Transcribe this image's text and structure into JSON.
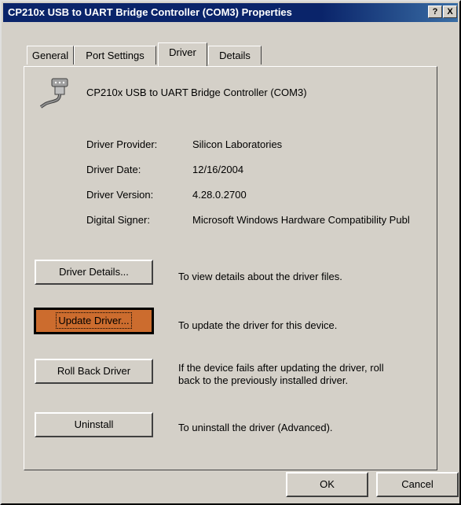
{
  "window": {
    "title": "CP210x USB to UART Bridge Controller (COM3) Properties",
    "help_btn": "?",
    "close_btn": "X"
  },
  "tabs": [
    {
      "label": "General"
    },
    {
      "label": "Port Settings"
    },
    {
      "label": "Driver",
      "active": true
    },
    {
      "label": "Details"
    }
  ],
  "device": {
    "icon": "serial-port-icon",
    "name": "CP210x USB to UART Bridge Controller (COM3)"
  },
  "properties": [
    {
      "label": "Driver Provider:",
      "value": "Silicon Laboratories"
    },
    {
      "label": "Driver Date:",
      "value": "12/16/2004"
    },
    {
      "label": "Driver Version:",
      "value": "4.28.0.2700"
    },
    {
      "label": "Digital Signer:",
      "value": "Microsoft Windows Hardware Compatibility Publ"
    }
  ],
  "actions": [
    {
      "button": "Driver Details...",
      "description": "To view details about the driver files."
    },
    {
      "button": "Update Driver...",
      "description": "To update the driver for this device."
    },
    {
      "button": "Roll Back Driver",
      "description": "If the device fails after updating the driver, roll",
      "description2": "back to the previously installed driver."
    },
    {
      "button": "Uninstall",
      "description": "To uninstall the driver (Advanced)."
    }
  ],
  "footer": {
    "ok": "OK",
    "cancel": "Cancel"
  },
  "colors": {
    "titlebar": "#0a246a",
    "face": "#d4d0c8",
    "focus_button": "#cc6c2e"
  }
}
